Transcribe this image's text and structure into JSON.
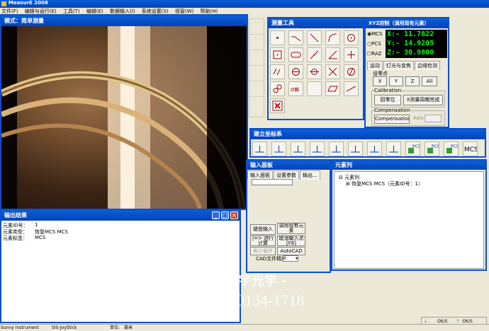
{
  "app": {
    "title": "MeasurE 2008"
  },
  "menu": [
    "文件(F)",
    "编辑与运行(E)",
    "工具(T)",
    "编辑(E)",
    "数据输入(I)",
    "系统设置(S)",
    "视窗(W)",
    "帮助(H)"
  ],
  "image_window": {
    "title": "模式：简单测量"
  },
  "measure_tools": {
    "title": "测量工具"
  },
  "xyz": {
    "title": "XYZ控制（调用现有元素）",
    "modes": [
      "MCS",
      "PCS",
      "RAZ"
    ],
    "x": "X:- 11.7822",
    "y": "Y:- 14.9205",
    "z": "Z:- 30.9800",
    "tabs": [
      "运动",
      "灯光与变焦",
      "边缘检测"
    ],
    "zero_label": "设零点",
    "zero_buttons": [
      "X",
      "Y",
      "Z",
      "All"
    ],
    "calibration_label": "Calibration",
    "calibration_buttons": [
      "回零位",
      "X测量周期完成"
    ],
    "compensation_label": "Compensation",
    "compensation_button": "Compensation",
    "axis_label": "Axis"
  },
  "coord": {
    "title": "建立坐标系"
  },
  "input_panel": {
    "title": "输入面板",
    "tabs": [
      "输入面板",
      "设置参数",
      "输出..."
    ],
    "buttons": {
      "keyboard": "键盘输入",
      "call": "调用现有元素",
      "run": "|=> 进行计算",
      "cancel": "取消输入点[F8]",
      "disabled": "再计循环",
      "autocad": "AutoCAD"
    },
    "cad_label": "CAD文件精度",
    "cad_value": "6"
  },
  "element_list": {
    "title": "元素列",
    "root": "元素列",
    "child": "恢复MCS MCS（元素ID号：1）"
  },
  "output": {
    "title": "输出结果",
    "rows": [
      {
        "label": "元素ID号：",
        "value": "1"
      },
      {
        "label": "元素类型：",
        "value": "恢复MCS MCS"
      },
      {
        "label": "元素标签：",
        "value": "MCS"
      }
    ]
  },
  "watermark": {
    "line1": "- 舜宇光学 -",
    "line2": "Tel 186-0134-1718"
  },
  "status": {
    "s1": "Sunny Instrument",
    "s2": "SIS-JoyStick",
    "unit_label": "单位:",
    "unit_value": "毫米"
  },
  "right_status": {
    "ok1": "OK/S",
    "ok2": "OK/S"
  }
}
